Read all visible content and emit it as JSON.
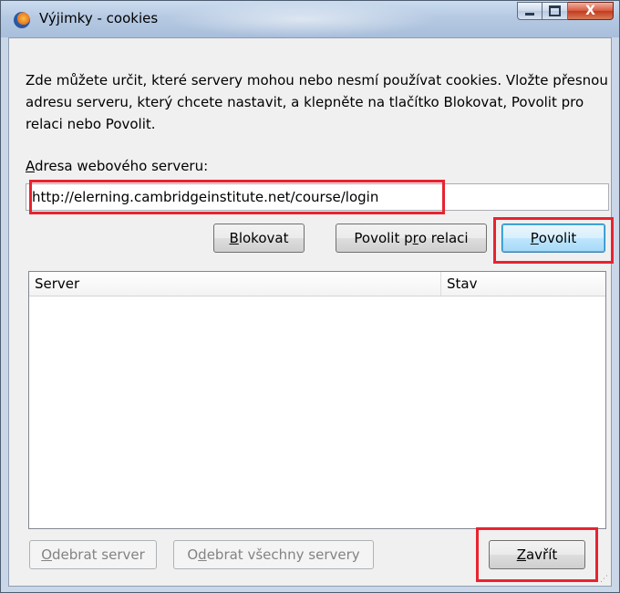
{
  "window": {
    "title": "Výjimky - cookies",
    "close_glyph": "X"
  },
  "description": "Zde můžete určit, které servery mohou nebo nesmí používat cookies. Vložte přesnou adresu serveru, který chcete nastavit, a klepněte na tlačítko Blokovat, Povolit pro relaci nebo Povolit.",
  "address": {
    "label_accel": "A",
    "label_rest": "dresa webového serveru:",
    "value": "http://elerning.cambridgeinstitute.net/course/login"
  },
  "buttons": {
    "block": {
      "accel": "B",
      "rest": "lokovat"
    },
    "session": {
      "pre": "Povolit p",
      "accel": "r",
      "rest": "o relaci"
    },
    "allow": {
      "accel": "P",
      "rest": "ovolit"
    },
    "remove": {
      "accel": "O",
      "rest": "debrat server"
    },
    "remove_all": {
      "pre": "O",
      "accel": "d",
      "rest": "ebrat všechny servery"
    },
    "close": {
      "accel": "Z",
      "rest": "avřít"
    }
  },
  "list": {
    "columns": [
      "Server",
      "Stav"
    ],
    "rows": []
  },
  "colors": {
    "highlight": "#e8232f",
    "title_bar": "#b5c9e2"
  }
}
